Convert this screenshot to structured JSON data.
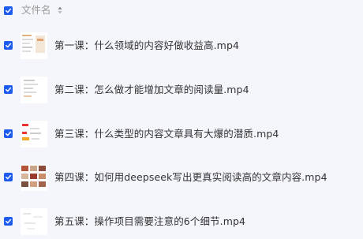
{
  "header": {
    "label": "文件名"
  },
  "files": [
    {
      "name": "第一课：什么领域的内容好做收益高.mp4"
    },
    {
      "name": "第二课：怎么做才能增加文章的阅读量.mp4"
    },
    {
      "name": "第三课：什么类型的内容文章具有大爆的潜质.mp4"
    },
    {
      "name": "第四课：如何用deepseek写出更真实阅读高的文章内容.mp4"
    },
    {
      "name": "第五课：操作项目需要注意的6个细节.mp4"
    }
  ],
  "colors": {
    "accent": "#1e5cf0",
    "background": "#f5f6fc"
  }
}
